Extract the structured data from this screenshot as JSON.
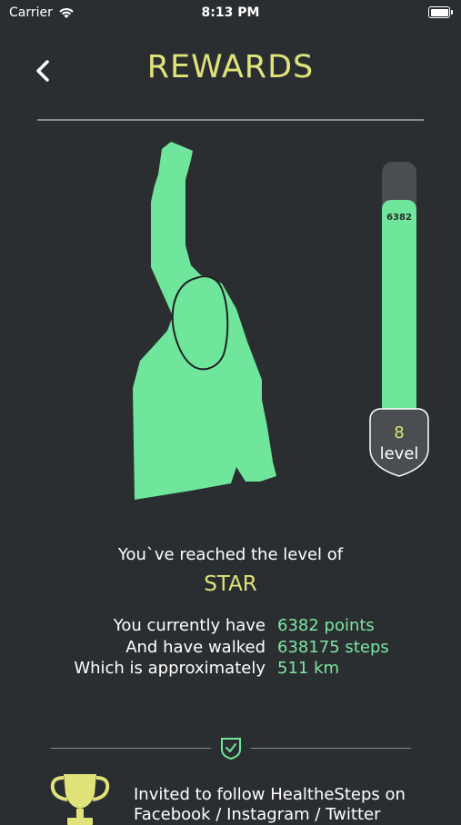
{
  "status_bar": {
    "carrier": "Carrier",
    "time": "8:13 PM"
  },
  "header": {
    "title": "REWARDS"
  },
  "gauge": {
    "points": "6382",
    "fill_fraction": 0.86,
    "level_number": "8",
    "level_label": "level"
  },
  "summary": {
    "reached_text": "You`ve reached the level of",
    "level_name": "STAR"
  },
  "stats": [
    {
      "label": "You currently have",
      "value": "6382 points"
    },
    {
      "label": "And have walked",
      "value": "638175 steps"
    },
    {
      "label": "Which is approximately",
      "value": "511 km"
    }
  ],
  "reward": {
    "text": "Invited to follow  HealtheSteps on Facebook / Instagram / Twitter"
  },
  "colors": {
    "background": "#2b2e31",
    "accent_yellow": "#dfe37a",
    "accent_green": "#6fe69c"
  }
}
